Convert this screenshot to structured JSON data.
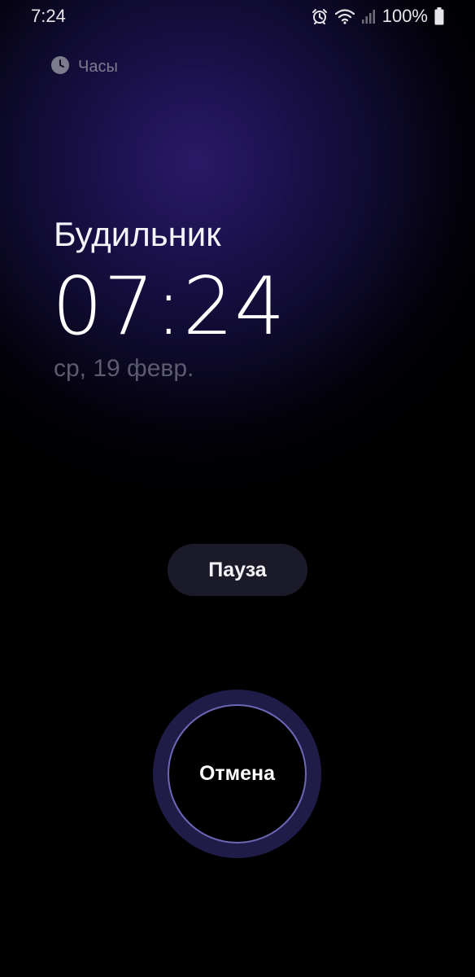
{
  "status_bar": {
    "time": "7:24",
    "battery_percent": "100%",
    "icons": [
      "alarm-icon",
      "wifi-icon",
      "signal-icon",
      "battery-icon"
    ]
  },
  "app": {
    "name": "Часы",
    "icon": "clock-icon"
  },
  "alarm": {
    "title": "Будильник",
    "time": "07:24",
    "date": "ср, 19 февр."
  },
  "actions": {
    "snooze_label": "Пауза",
    "dismiss_label": "Отмена"
  },
  "colors": {
    "background": "#000000",
    "glow": "#2a1a66",
    "snooze_bg": "#1b1a28",
    "dismiss_ring": "#1f1d48",
    "dismiss_border": "#6c67b4",
    "date_text": "#5d5b70"
  }
}
